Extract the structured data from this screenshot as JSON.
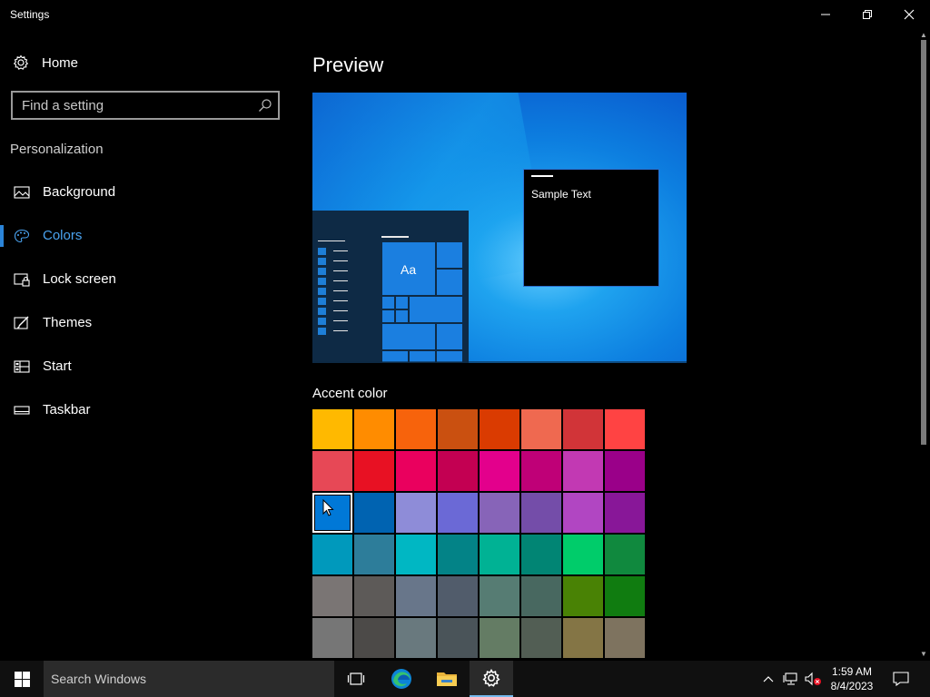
{
  "window": {
    "title": "Settings"
  },
  "sidebar": {
    "home_label": "Home",
    "search_placeholder": "Find a setting",
    "section_label": "Personalization",
    "items": [
      {
        "label": "Background",
        "icon": "picture-icon",
        "active": false
      },
      {
        "label": "Colors",
        "icon": "palette-icon",
        "active": true
      },
      {
        "label": "Lock screen",
        "icon": "lock-screen-icon",
        "active": false
      },
      {
        "label": "Themes",
        "icon": "brush-icon",
        "active": false
      },
      {
        "label": "Start",
        "icon": "start-layout-icon",
        "active": false
      },
      {
        "label": "Taskbar",
        "icon": "taskbar-icon",
        "active": false
      }
    ]
  },
  "main": {
    "title": "Preview",
    "preview": {
      "sample_text": "Sample Text",
      "tile_text": "Aa"
    },
    "accent_label": "Accent color",
    "accent_colors": [
      [
        "#FFB900",
        "#FF8C00",
        "#F7630C",
        "#CA5010",
        "#DA3B01",
        "#EF6950",
        "#D13438",
        "#FF4343"
      ],
      [
        "#E74856",
        "#E81123",
        "#EA005E",
        "#C30052",
        "#E3008C",
        "#BF0077",
        "#C239B3",
        "#9A0089"
      ],
      [
        "#0078D7",
        "#0063B1",
        "#8E8CD8",
        "#6B69D6",
        "#8764B8",
        "#744DA9",
        "#B146C2",
        "#881798"
      ],
      [
        "#0099BC",
        "#2D7D9A",
        "#00B7C3",
        "#038387",
        "#00B294",
        "#018574",
        "#00CC6A",
        "#10893E"
      ],
      [
        "#7A7574",
        "#5D5A58",
        "#68768A",
        "#515C6B",
        "#567C73",
        "#486860",
        "#498205",
        "#107C10"
      ],
      [
        "#767676",
        "#4C4A48",
        "#69797E",
        "#4A5459",
        "#647C64",
        "#525E54",
        "#847545",
        "#7E735F"
      ]
    ],
    "selected_color": "#0078D7"
  },
  "taskbar": {
    "search_placeholder": "Search Windows",
    "time": "1:59 AM",
    "date": "8/4/2023",
    "pinned": [
      "task-view-icon",
      "edge-icon",
      "file-explorer-icon",
      "settings-icon"
    ]
  }
}
